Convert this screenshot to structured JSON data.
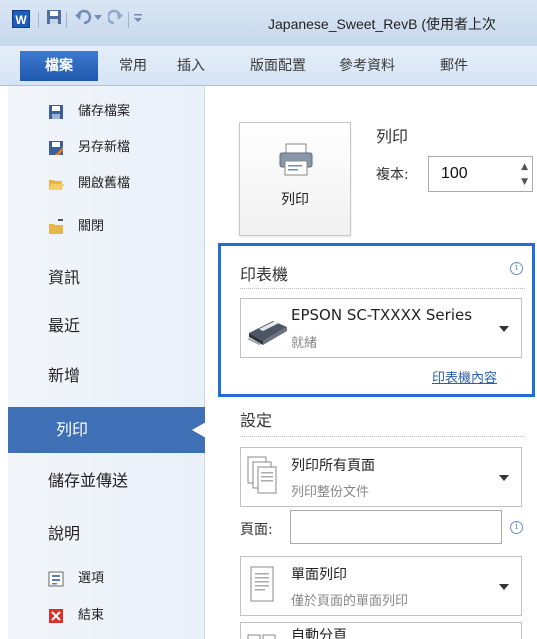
{
  "app": {
    "logo_letter": "W",
    "document_title": "Japanese_Sweet_RevB (使用者上次",
    "quick_access": [
      "save-icon",
      "undo-icon",
      "redo-icon",
      "customize-icon"
    ]
  },
  "ribbon": {
    "tabs": [
      "檔案",
      "常用",
      "插入",
      "版面配置",
      "參考資料",
      "郵件"
    ]
  },
  "sidebar": {
    "small_items": [
      {
        "label": "儲存檔案",
        "icon": "save-icon"
      },
      {
        "label": "另存新檔",
        "icon": "save-as-icon"
      },
      {
        "label": "開啟舊檔",
        "icon": "open-folder-icon"
      },
      {
        "label": "關閉",
        "icon": "close-folder-icon"
      }
    ],
    "big_items": [
      "資訊",
      "最近",
      "新增",
      "列印",
      "儲存並傳送",
      "說明"
    ],
    "selected": "列印",
    "bottom_items": [
      {
        "label": "選項",
        "icon": "options-icon"
      },
      {
        "label": "結束",
        "icon": "exit-icon"
      }
    ]
  },
  "print": {
    "section_title": "列印",
    "button_label": "列印",
    "copies_label": "複本:",
    "copies_value": "100"
  },
  "printer": {
    "title": "印表機",
    "name": "EPSON SC-TXXXX Series",
    "status": "就緒",
    "properties_link": "印表機內容"
  },
  "settings": {
    "title": "設定",
    "print_range": {
      "main": "列印所有頁面",
      "sub": "列印整份文件"
    },
    "pages_label": "頁面:",
    "pages_value": "",
    "sides": {
      "main": "單面列印",
      "sub": "僅於頁面的單面列印"
    },
    "collate": {
      "main": "自動分頁"
    }
  },
  "colors": {
    "accent": "#1f6fd6",
    "selected_bg": "#3f6fb5",
    "file_tab": "#2a65bd"
  }
}
